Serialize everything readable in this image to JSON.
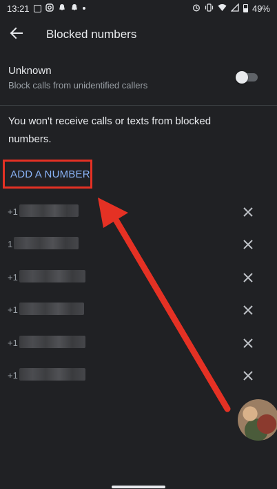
{
  "status_bar": {
    "time": "13:21",
    "battery": "49%",
    "left_icons": [
      "notification-icon",
      "instagram-icon",
      "snapchat-icon",
      "snapchat-icon",
      "more-dot-icon"
    ],
    "right_icons": [
      "alarm-icon",
      "vibrate-icon",
      "wifi-icon",
      "signal-icon",
      "battery-icon"
    ]
  },
  "appbar": {
    "title": "Blocked numbers"
  },
  "unknown": {
    "title": "Unknown",
    "subtitle": "Block calls from unidentified callers",
    "enabled": false
  },
  "info_text": "You won't receive calls or texts from blocked numbers.",
  "add_button": "ADD A NUMBER",
  "blocked_numbers": [
    {
      "prefix": "+1"
    },
    {
      "prefix": "1"
    },
    {
      "prefix": "+1"
    },
    {
      "prefix": "+1"
    },
    {
      "prefix": "+1"
    },
    {
      "prefix": "+1"
    }
  ],
  "colors": {
    "background": "#202124",
    "accent": "#8ab4f8",
    "highlight": "#e53124"
  }
}
